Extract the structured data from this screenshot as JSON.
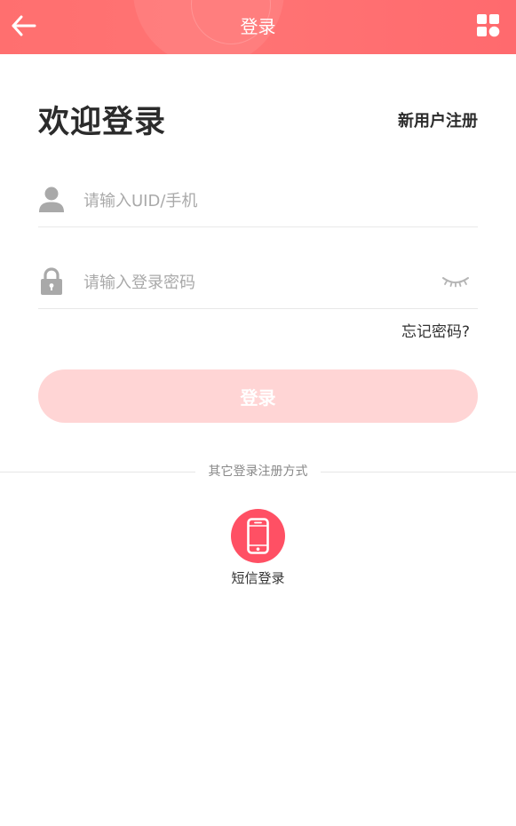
{
  "header": {
    "title": "登录",
    "back_icon": "arrow-left-icon",
    "apps_icon": "apps-grid-icon"
  },
  "welcome": {
    "title": "欢迎登录",
    "register_link": "新用户注册"
  },
  "form": {
    "uid_placeholder": "请输入UID/手机",
    "uid_icon": "user-icon",
    "password_placeholder": "请输入登录密码",
    "password_icon": "lock-icon",
    "eye_icon": "eye-closed-icon",
    "forgot_password": "忘记密码?",
    "login_button": "登录"
  },
  "other_methods": {
    "divider_text": "其它登录注册方式",
    "sms_label": "短信登录",
    "sms_icon": "phone-icon"
  },
  "colors": {
    "header_bg": "#ff6f6f",
    "login_button_bg": "#ffd5d5",
    "sms_button_bg": "#ff5064",
    "icon_gray": "#a9a9a9"
  }
}
